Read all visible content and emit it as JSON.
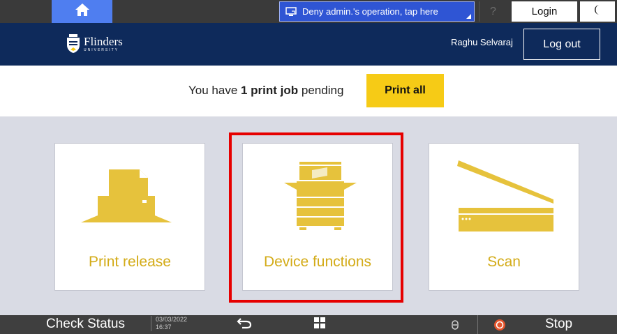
{
  "system_bar": {
    "home_icon": "home-icon",
    "deny_admin_label": "Deny admin.'s operation, tap here",
    "help_label": "?",
    "login_label": "Login",
    "moon_icon": "moon-icon"
  },
  "header": {
    "logo_name": "Flinders",
    "logo_sub": "UNIVERSITY",
    "user_name": "Raghu Selvaraj",
    "logout_label": "Log out"
  },
  "pending": {
    "prefix": "You have ",
    "count_text": "1 print job",
    "suffix": " pending",
    "print_all_label": "Print all"
  },
  "tiles": [
    {
      "label": "Print release",
      "icon": "printer-icon"
    },
    {
      "label": "Device functions",
      "icon": "copier-icon"
    },
    {
      "label": "Scan",
      "icon": "scanner-icon"
    }
  ],
  "bottom_bar": {
    "check_status_label": "Check Status",
    "date": "03/03/2022",
    "time": "16:37",
    "stop_label": "Stop"
  },
  "colors": {
    "accent_yellow": "#f6cb16",
    "icon_gold": "#e6c23c",
    "header_navy": "#0e2a5b",
    "highlight_red": "#e60000",
    "home_blue": "#4f7ef0"
  }
}
